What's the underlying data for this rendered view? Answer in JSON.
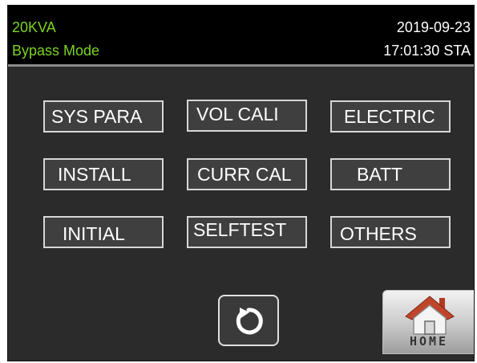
{
  "status": {
    "capacity": "20KVA",
    "mode": "Bypass Mode",
    "date": "2019-09-23",
    "time": "17:01:30 STA"
  },
  "menu": {
    "row1": [
      "SYS PARA",
      "VOL CALI",
      "ELECTRIC"
    ],
    "row2": [
      "INSTALL",
      "CURR CAL",
      "BATT"
    ],
    "row3": [
      "INITIAL",
      "SELFTEST",
      "OTHERS"
    ]
  },
  "nav": {
    "back_icon": "refresh-arrow-icon",
    "home_icon": "house-icon",
    "home_label": "HOME"
  },
  "colors": {
    "status_green": "#7cd321",
    "button_border": "#d6d6d6",
    "roof_red": "#c0452a"
  }
}
